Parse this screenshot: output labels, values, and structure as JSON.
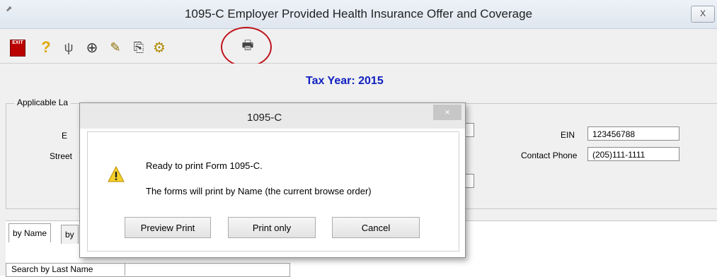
{
  "window": {
    "title": "1095-C Employer Provided Health Insurance Offer and Coverage",
    "close_label": "X"
  },
  "toolbar": {
    "exit_label": "EXIT",
    "icons": [
      "exit-icon",
      "help-icon",
      "tools-icon",
      "add-icon",
      "edit-icon",
      "copy-icon",
      "gears-icon",
      "print-icon"
    ]
  },
  "main": {
    "tax_year": "Tax Year: 2015",
    "group_label": "Applicable La",
    "fields": {
      "name_label": "E",
      "street_label": "Street",
      "ein_label": "EIN",
      "ein_value": "123456788",
      "contact_phone_label": "Contact Phone",
      "contact_phone_value": "(205)111-1111"
    },
    "tabs": [
      {
        "label": "by Name"
      },
      {
        "label": "by"
      }
    ],
    "search_label": "Search by Last Name"
  },
  "dialog": {
    "title": "1095-C",
    "close_label": "×",
    "message_line1": "Ready to print Form 1095-C.",
    "message_line2": "The forms will print by Name (the current browse order)",
    "buttons": [
      "Preview Print",
      "Print only",
      "Cancel"
    ]
  },
  "colors": {
    "tax_year": "#1020c0",
    "annotation": "#c0141c"
  }
}
